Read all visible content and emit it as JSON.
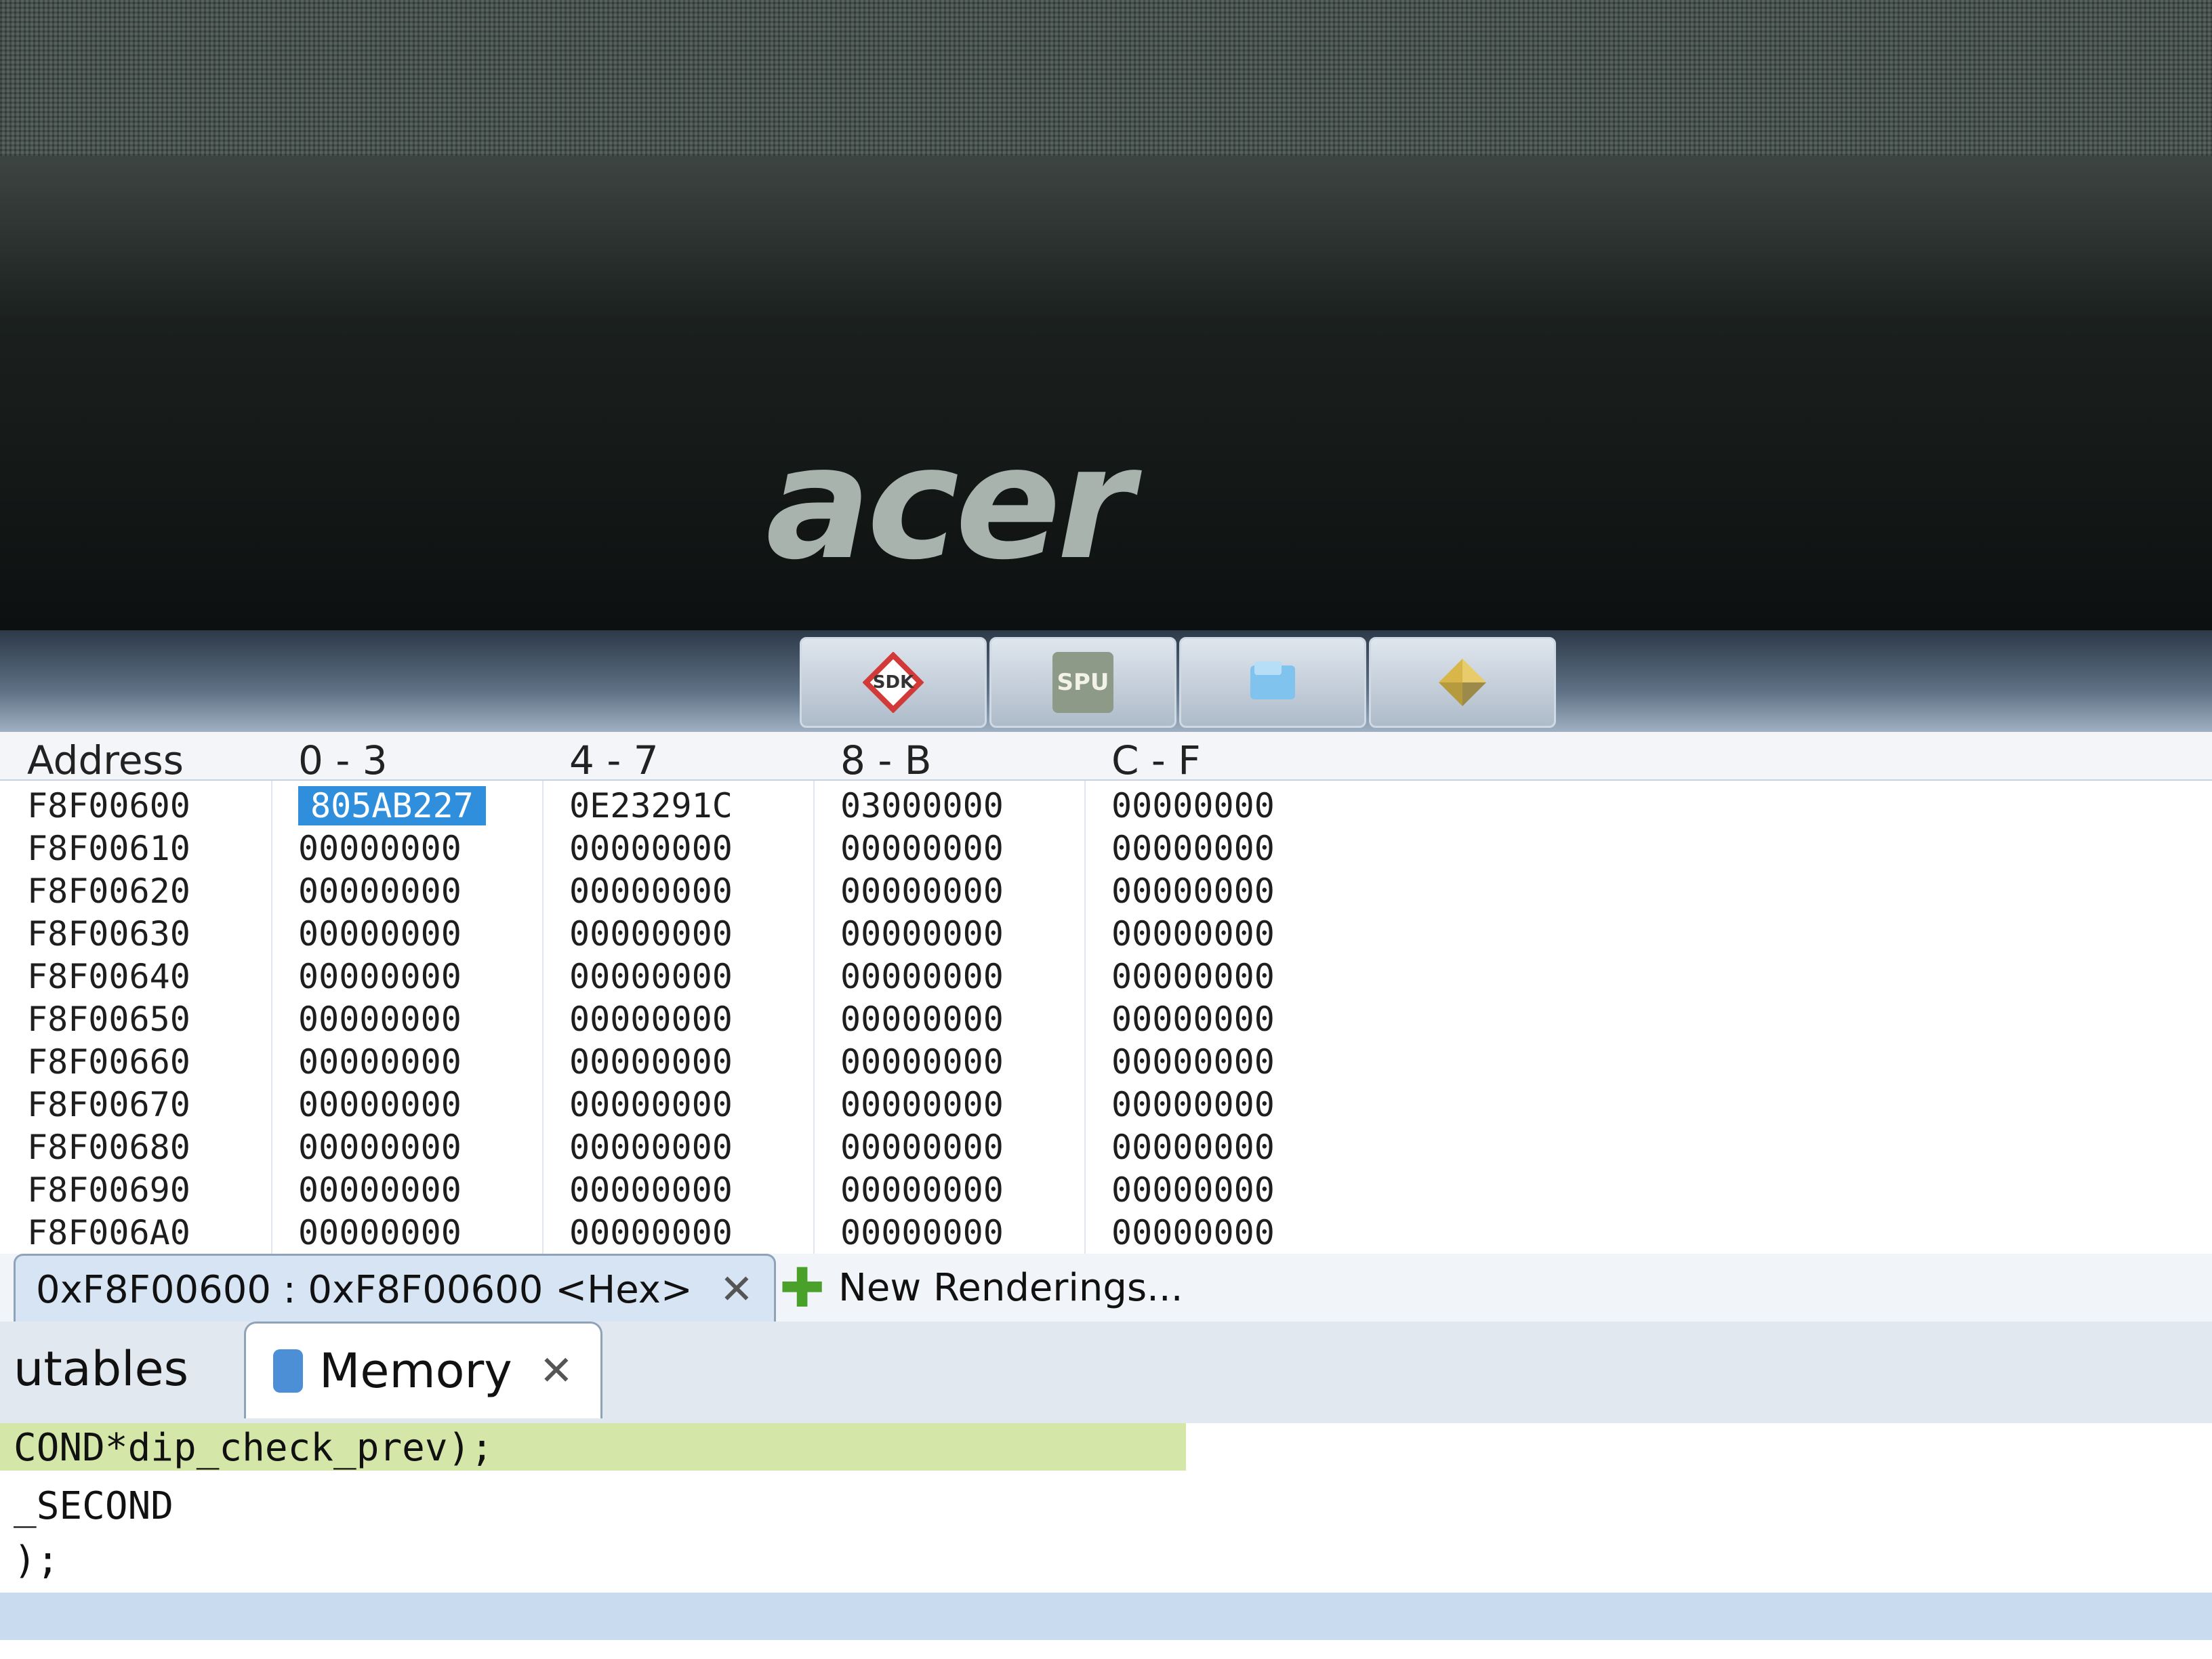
{
  "brand": "acer",
  "taskbar": {
    "buttons": [
      {
        "label": "",
        "icon": "flag-app-icon"
      },
      {
        "label": "",
        "icon": "folder-app-icon"
      },
      {
        "label": "SPU",
        "icon": "spu-app-icon"
      },
      {
        "label": "SDK",
        "icon": "sdk-app-icon"
      }
    ]
  },
  "editor": {
    "lines": [
      ");",
      "_SECOND",
      "COND*dip_check_prev);"
    ]
  },
  "views": {
    "tabs": [
      {
        "label": "utables"
      },
      {
        "label": "Memory",
        "icon": "memory-icon"
      }
    ]
  },
  "memory": {
    "rendering_tab": "0xF8F00600 : 0xF8F00600 <Hex>",
    "new_rendering": "New Renderings...",
    "headers": [
      "Address",
      "0 - 3",
      "4 - 7",
      "8 - B",
      "C - F"
    ],
    "rows": [
      [
        "F8F00600",
        "805AB227",
        "0E23291C",
        "03000000",
        "00000000"
      ],
      [
        "F8F00610",
        "00000000",
        "00000000",
        "00000000",
        "00000000"
      ],
      [
        "F8F00620",
        "00000000",
        "00000000",
        "00000000",
        "00000000"
      ],
      [
        "F8F00630",
        "00000000",
        "00000000",
        "00000000",
        "00000000"
      ],
      [
        "F8F00640",
        "00000000",
        "00000000",
        "00000000",
        "00000000"
      ],
      [
        "F8F00650",
        "00000000",
        "00000000",
        "00000000",
        "00000000"
      ],
      [
        "F8F00660",
        "00000000",
        "00000000",
        "00000000",
        "00000000"
      ],
      [
        "F8F00670",
        "00000000",
        "00000000",
        "00000000",
        "00000000"
      ],
      [
        "F8F00680",
        "00000000",
        "00000000",
        "00000000",
        "00000000"
      ],
      [
        "F8F00690",
        "00000000",
        "00000000",
        "00000000",
        "00000000"
      ],
      [
        "F8F006A0",
        "00000000",
        "00000000",
        "00000000",
        "00000000"
      ]
    ],
    "selected_cell": "805AB227"
  },
  "colors": {
    "selection": "#2f8fdc",
    "code_highlight": "#d4e7a8",
    "add_icon": "#4aa12a"
  }
}
